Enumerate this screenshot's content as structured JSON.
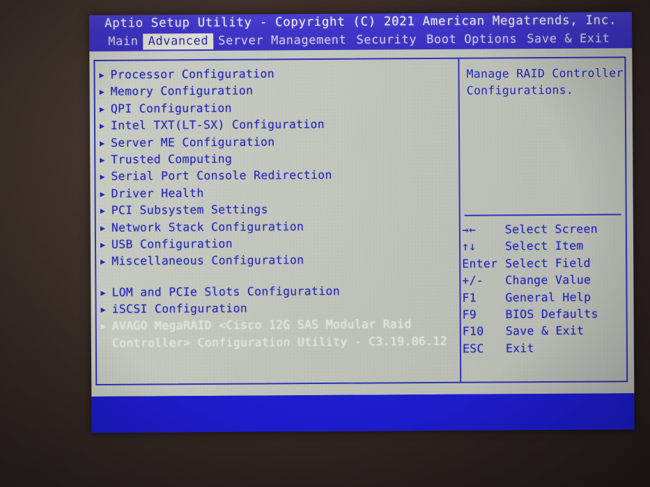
{
  "header": {
    "title": "Aptio Setup Utility - Copyright (C) 2021 American Megatrends, Inc.",
    "tabs": [
      {
        "label": "Main",
        "active": false
      },
      {
        "label": "Advanced",
        "active": true
      },
      {
        "label": "Server Management",
        "active": false
      },
      {
        "label": "Security",
        "active": false
      },
      {
        "label": "Boot Options",
        "active": false
      },
      {
        "label": "Save & Exit",
        "active": false
      }
    ]
  },
  "menu": {
    "bullet": "▶",
    "items": [
      {
        "label": "Processor Configuration",
        "dim": false,
        "gap_before": false
      },
      {
        "label": "Memory Configuration",
        "dim": false,
        "gap_before": false
      },
      {
        "label": "QPI Configuration",
        "dim": false,
        "gap_before": false
      },
      {
        "label": "Intel TXT(LT-SX) Configuration",
        "dim": false,
        "gap_before": false
      },
      {
        "label": "Server ME Configuration",
        "dim": false,
        "gap_before": false
      },
      {
        "label": "Trusted Computing",
        "dim": false,
        "gap_before": false
      },
      {
        "label": "Serial Port Console Redirection",
        "dim": false,
        "gap_before": false
      },
      {
        "label": "Driver Health",
        "dim": false,
        "gap_before": false
      },
      {
        "label": "PCI Subsystem Settings",
        "dim": false,
        "gap_before": false
      },
      {
        "label": "Network Stack Configuration",
        "dim": false,
        "gap_before": false
      },
      {
        "label": "USB Configuration",
        "dim": false,
        "gap_before": false
      },
      {
        "label": "Miscellaneous Configuration",
        "dim": false,
        "gap_before": false
      },
      {
        "label": "LOM and PCIe Slots Configuration",
        "dim": false,
        "gap_before": true
      },
      {
        "label": "iSCSI Configuration",
        "dim": false,
        "gap_before": false
      },
      {
        "label": "AVAGO MegaRAID <Cisco 12G SAS Modular Raid",
        "dim": true,
        "gap_before": false
      },
      {
        "label": "Controller> Configuration Utility - C3.19.06.12",
        "dim": true,
        "gap_before": false,
        "continuation": true
      }
    ]
  },
  "help": {
    "lines": [
      "Manage RAID Controller",
      "Configurations."
    ]
  },
  "keys": [
    {
      "cap": "→←",
      "desc": "Select Screen"
    },
    {
      "cap": "↑↓",
      "desc": "Select Item"
    },
    {
      "cap": "Enter",
      "desc": "Select Field"
    },
    {
      "cap": "+/-",
      "desc": "Change Value"
    },
    {
      "cap": "F1",
      "desc": "General Help"
    },
    {
      "cap": "F9",
      "desc": "BIOS Defaults"
    },
    {
      "cap": "F10",
      "desc": "Save & Exit"
    },
    {
      "cap": "ESC",
      "desc": "Exit"
    }
  ],
  "colors": {
    "header_blue": "#4036c4",
    "screen_blue": "#1c1ccb",
    "panel_gray": "#c9cec3",
    "text_blue": "#2525bb",
    "dim_text": "#dfe3da",
    "active_tab_bg": "#dcdcd0",
    "bezel_brown": "#3a2d27"
  }
}
